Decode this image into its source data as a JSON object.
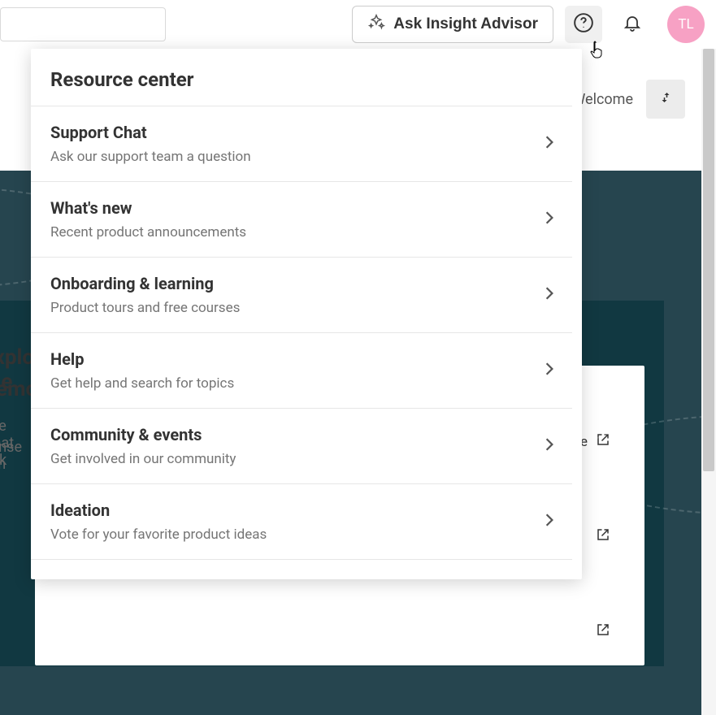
{
  "topbar": {
    "ask_label": "Ask Insight Advisor",
    "avatar_initials": "TL"
  },
  "welcome": {
    "label": "Welcome"
  },
  "background": {
    "heading1": "Explore the",
    "heading2": "Demo",
    "para1": "See what Qlik",
    "para2": "Sense can",
    "link_suffix": "ne"
  },
  "popover": {
    "title": "Resource center",
    "items": [
      {
        "title": "Support Chat",
        "sub": "Ask our support team a question"
      },
      {
        "title": "What's new",
        "sub": "Recent product announcements"
      },
      {
        "title": "Onboarding & learning",
        "sub": "Product tours and free courses"
      },
      {
        "title": "Help",
        "sub": "Get help and search for topics"
      },
      {
        "title": "Community & events",
        "sub": "Get involved in our community"
      },
      {
        "title": "Ideation",
        "sub": "Vote for your favorite product ideas"
      }
    ]
  }
}
